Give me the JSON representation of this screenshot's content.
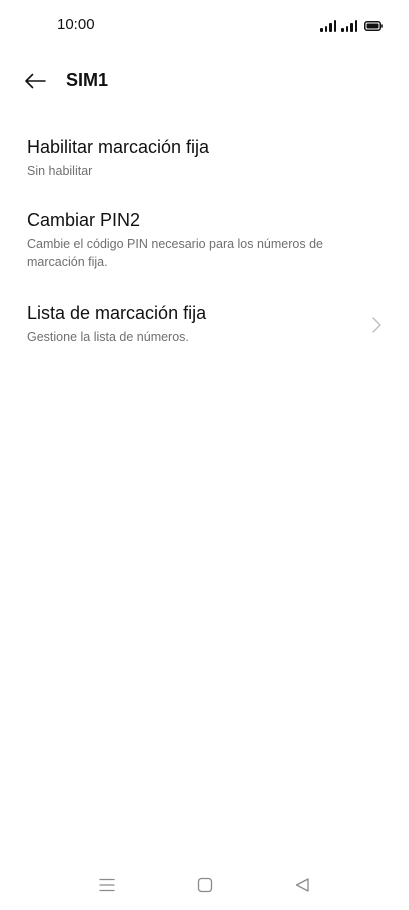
{
  "status_bar": {
    "time": "10:00"
  },
  "app_bar": {
    "title": "SIM1",
    "back_icon": "arrow-left-icon"
  },
  "settings": [
    {
      "title": "Habilitar marcación fija",
      "subtitle": "Sin habilitar"
    },
    {
      "title": "Cambiar PIN2",
      "subtitle": "Cambie el código PIN necesario para los números de marcación fija."
    },
    {
      "title": "Lista de marcación fija",
      "subtitle": "Gestione la lista de números.",
      "trailing_icon": "chevron-right-icon"
    }
  ],
  "nav_bar": {
    "menu_icon": "menu-icon",
    "home_icon": "home-square-icon",
    "back_icon": "back-triangle-icon"
  },
  "colors": {
    "background": "#ffffff",
    "primary_text": "#111111",
    "secondary_text": "#707070",
    "chevron": "#bdbdbd",
    "nav_icons": "#8a8a8a"
  }
}
